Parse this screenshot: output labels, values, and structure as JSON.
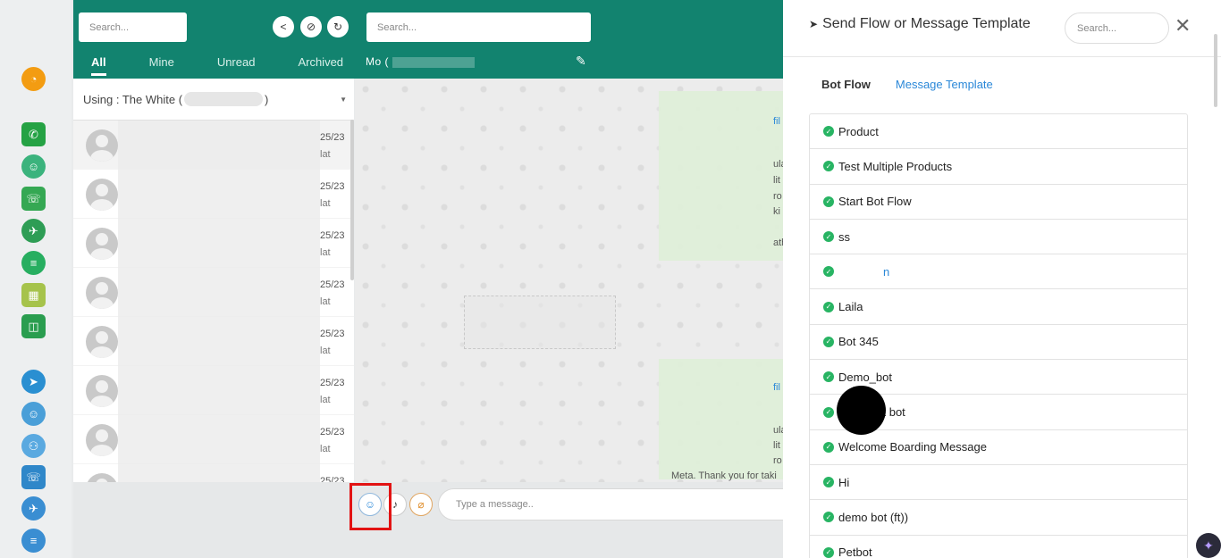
{
  "colors": {
    "brand": "#12836f",
    "accent_link": "#2b88d8",
    "success": "#28b463",
    "highlight": "#e21313"
  },
  "header": {
    "search_placeholder": "Search...",
    "chat_search_placeholder": "Search...",
    "tabs": [
      {
        "label": "All",
        "active": true
      },
      {
        "label": "Mine"
      },
      {
        "label": "Unread"
      },
      {
        "label": "Archived"
      }
    ],
    "contact_label": "Mo ("
  },
  "conversations": {
    "using_label": "Using : The White (",
    "using_suffix": ")",
    "rows": [
      {
        "date": "25/23",
        "tag": "lat"
      },
      {
        "date": "25/23",
        "tag": "lat"
      },
      {
        "date": "25/23",
        "tag": "lat"
      },
      {
        "date": "25/23",
        "tag": "lat"
      },
      {
        "date": "25/23",
        "tag": "lat"
      },
      {
        "date": "25/23",
        "tag": "lat"
      },
      {
        "date": "25/23",
        "tag": "lat"
      },
      {
        "date": "25/23",
        "tag": "lat"
      }
    ]
  },
  "chat": {
    "snippets": [
      "fil",
      "ula",
      "lit",
      "ro",
      "ki",
      "ath",
      "fil",
      "ula",
      "lit",
      "ro"
    ],
    "visible_message": "Meta. Thank you for taki",
    "input_placeholder": "Type a message.."
  },
  "panel": {
    "title": "Send Flow or Message Template",
    "search_placeholder": "Search...",
    "close_label": "✕",
    "tabs": [
      {
        "label": "Bot Flow",
        "active": true
      },
      {
        "label": "Message Template"
      }
    ],
    "flows": [
      "Product",
      "Test Multiple Products",
      "Start Bot Flow",
      "ss",
      "n",
      "Laila",
      "Bot 345",
      "Demo_bot",
      "st bot",
      "Welcome Boarding Message",
      "Hi",
      "demo bot (ft))",
      "Petbot"
    ]
  }
}
